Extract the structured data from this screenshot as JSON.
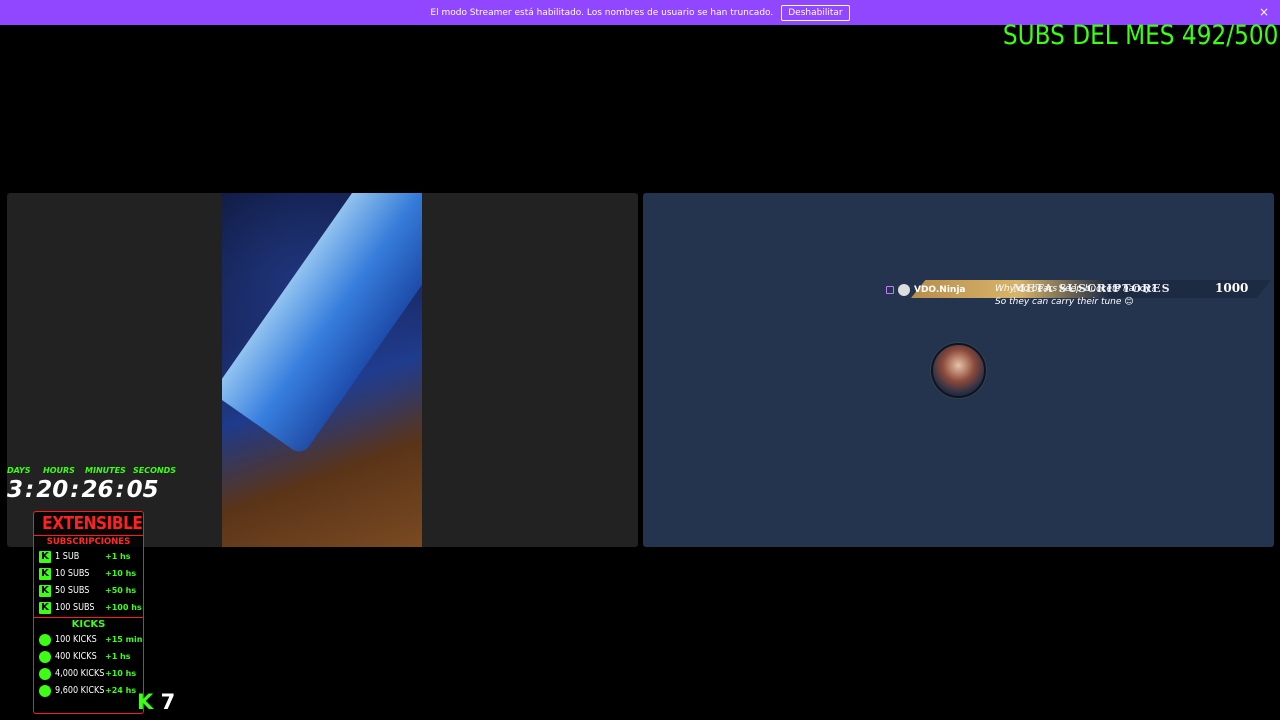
{
  "banner": {
    "message": "El modo Streamer está habilitado. Los nombres de usuario se han truncado.",
    "disable_label": "Deshabilitar",
    "close_icon": "×"
  },
  "overlay": {
    "subs_month": "SUBS DEL MES 492/500"
  },
  "sub_bar": {
    "title": "META SUSCRIPTORES",
    "goal": "1000"
  },
  "chat": {
    "platform_icon": "twitch-icon",
    "username": "VDO.Ninja",
    "line1": "Why do bears keep buckets handy?",
    "line2": "So they can carry their tune 😊"
  },
  "timer": {
    "labels": [
      "DAYS",
      "HOURS",
      "MINUTES",
      "SECONDS"
    ],
    "days": "3",
    "hours": "20",
    "minutes": "26",
    "seconds": "05",
    "separator": ":"
  },
  "extensible": {
    "title": "EXTENSIBLE",
    "subs_header": "SUBSCRIPCIONES",
    "subs": [
      {
        "label": "1 SUB",
        "value": "+1 hs"
      },
      {
        "label": "10 SUBS",
        "value": "+10 hs"
      },
      {
        "label": "50 SUBS",
        "value": "+50 hs"
      },
      {
        "label": "100 SUBS",
        "value": "+100 hs"
      }
    ],
    "kicks_header": "KICKS",
    "kicks": [
      {
        "label": "100 KICKS",
        "value": "+15 min"
      },
      {
        "label": "400 KICKS",
        "value": "+1 hs"
      },
      {
        "label": "4,000 KICKS",
        "value": "+10 hs"
      },
      {
        "label": "9,600 KICKS",
        "value": "+24 hs"
      }
    ]
  },
  "bottom_counter": {
    "value": "7"
  },
  "colors": {
    "banner": "#9146ff",
    "accent_green": "#3cff14",
    "accent_red": "#ff1a1a",
    "right_panel": "#25344e"
  }
}
